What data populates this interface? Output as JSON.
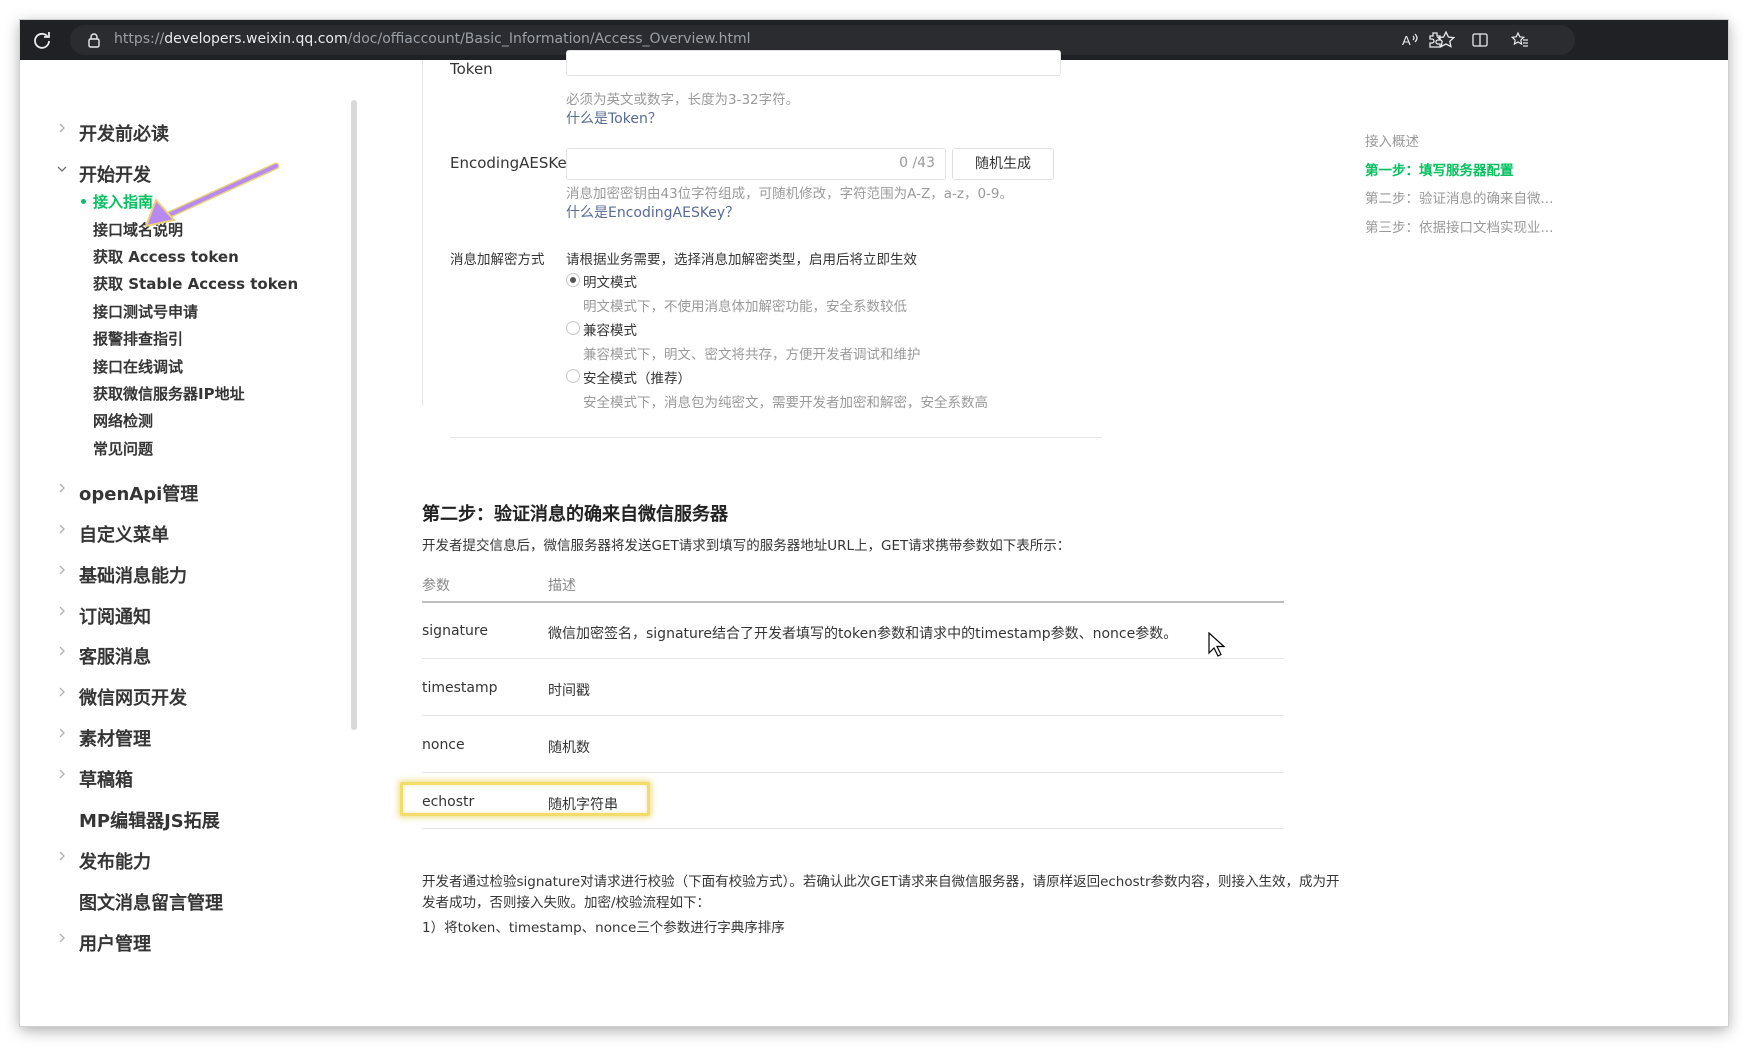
{
  "browser": {
    "url_prefix": "https://",
    "url_host": "developers.weixin.qq.com",
    "url_path": "/doc/offiaccount/Basic_Information/Access_Overview.html"
  },
  "sidebar": {
    "sections": [
      {
        "label": "开发前必读"
      },
      {
        "label": "开始开发"
      },
      {
        "label": "openApi管理"
      },
      {
        "label": "自定义菜单"
      },
      {
        "label": "基础消息能力"
      },
      {
        "label": "订阅通知"
      },
      {
        "label": "客服消息"
      },
      {
        "label": "微信网页开发"
      },
      {
        "label": "素材管理"
      },
      {
        "label": "草稿箱"
      },
      {
        "label": "MP编辑器JS拓展"
      },
      {
        "label": "发布能力"
      },
      {
        "label": "图文消息留言管理"
      },
      {
        "label": "用户管理"
      }
    ],
    "sub_items": [
      {
        "label": "接入指南",
        "active": true
      },
      {
        "label": "接口域名说明"
      },
      {
        "label": "获取 Access token"
      },
      {
        "label": "获取 Stable Access token"
      },
      {
        "label": "接口测试号申请"
      },
      {
        "label": "报警排查指引"
      },
      {
        "label": "接口在线调试"
      },
      {
        "label": "获取微信服务器IP地址"
      },
      {
        "label": "网络检测"
      },
      {
        "label": "常见问题"
      }
    ]
  },
  "form": {
    "token_label": "Token",
    "token_hint": "必须为英文或数字，长度为3-32字符。",
    "token_link": "什么是Token？",
    "aes_label": "EncodingAESKey",
    "aes_counter": "0 /43",
    "aes_button": "随机生成",
    "aes_hint": "消息加密密钥由43位字符组成，可随机修改，字符范围为A-Z，a-z，0-9。",
    "aes_link": "什么是EncodingAESKey？",
    "mode_label": "消息加解密方式",
    "mode_intro": "请根据业务需要，选择消息加解密类型，启用后将立即生效",
    "modes": [
      {
        "name": "明文模式",
        "desc": "明文模式下，不使用消息体加解密功能，安全系数较低",
        "selected": true
      },
      {
        "name": "兼容模式",
        "desc": "兼容模式下，明文、密文将共存，方便开发者调试和维护",
        "selected": false
      },
      {
        "name": "安全模式（推荐）",
        "desc": "安全模式下，消息包为纯密文，需要开发者加密和解密，安全系数高",
        "selected": false
      }
    ]
  },
  "step2": {
    "title": "第二步：验证消息的确来自微信服务器",
    "intro": "开发者提交信息后，微信服务器将发送GET请求到填写的服务器地址URL上，GET请求携带参数如下表所示：",
    "columns": [
      "参数",
      "描述"
    ],
    "rows": [
      {
        "param": "signature",
        "desc": "微信加密签名，signature结合了开发者填写的token参数和请求中的timestamp参数、nonce参数。"
      },
      {
        "param": "timestamp",
        "desc": "时间戳"
      },
      {
        "param": "nonce",
        "desc": "随机数"
      },
      {
        "param": "echostr",
        "desc": "随机字符串"
      }
    ],
    "after_line1": "开发者通过检验signature对请求进行校验（下面有校验方式）。若确认此次GET请求来自微信服务器，请原样返回echostr参数内容，则接入生效，成为开",
    "after_line2": "发者成功，否则接入失败。加密/校验流程如下：",
    "after_line3": "1）将token、timestamp、nonce三个参数进行字典序排序"
  },
  "toc": {
    "items": [
      {
        "label": "接入概述"
      },
      {
        "label": "第一步：填写服务器配置",
        "active": true
      },
      {
        "label": "第二步：验证消息的确来自微..."
      },
      {
        "label": "第三步：依据接口文档实现业..."
      }
    ]
  },
  "colors": {
    "accent_green": "#07c160",
    "link_blue": "#576b95",
    "highlight_yellow": "#f3dc6a",
    "arrow_purple": "#b889f0"
  }
}
